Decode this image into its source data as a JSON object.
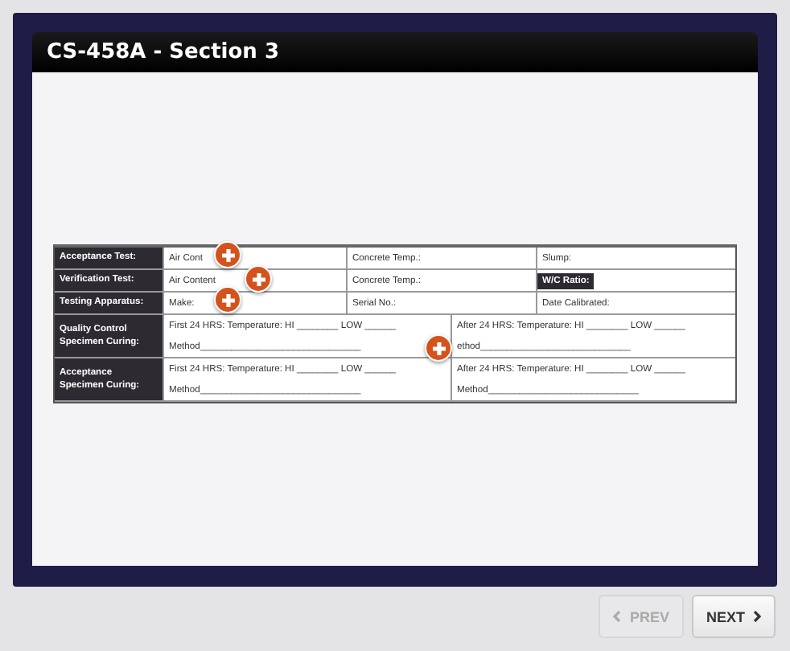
{
  "window": {
    "title": "CS-458A - Section 3"
  },
  "form": {
    "rows": [
      {
        "label": "Acceptance Test:",
        "cells": [
          {
            "text": "Air Cont",
            "kind": "plain"
          },
          {
            "text": "Concrete Temp.:",
            "kind": "plain"
          },
          {
            "text": "Slump:",
            "kind": "plain"
          }
        ]
      },
      {
        "label": "Verification Test:",
        "cells": [
          {
            "text": "Air Content",
            "kind": "plain"
          },
          {
            "text": "Concrete Temp.:",
            "kind": "plain"
          },
          {
            "text": "W/C Ratio:",
            "kind": "dark"
          }
        ]
      },
      {
        "label": "Testing Apparatus:",
        "cells": [
          {
            "text": "Make:",
            "kind": "plain"
          },
          {
            "text": "Serial No.:",
            "kind": "plain"
          },
          {
            "text": "Date Calibrated:",
            "kind": "plain"
          }
        ]
      }
    ],
    "curing_rows": [
      {
        "label": "Quality Control Specimen Curing:",
        "first": "First 24 HRS: Temperature: HI ________ LOW ______",
        "first_method": "Method_______________________________",
        "after": "After 24 HRS: Temperature: HI ________ LOW ______",
        "after_method": "ethod_____________________________"
      },
      {
        "label": "Acceptance Specimen Curing:",
        "first": "First 24 HRS: Temperature: HI ________ LOW ______",
        "first_method": "Method_______________________________",
        "after": "After 24 HRS: Temperature: HI ________ LOW ______",
        "after_method": "Method_____________________________"
      }
    ]
  },
  "navigation": [
    {
      "label": "PREV",
      "kind": "prev",
      "disabled": true
    },
    {
      "label": "NEXT",
      "kind": "next",
      "disabled": false
    }
  ]
}
